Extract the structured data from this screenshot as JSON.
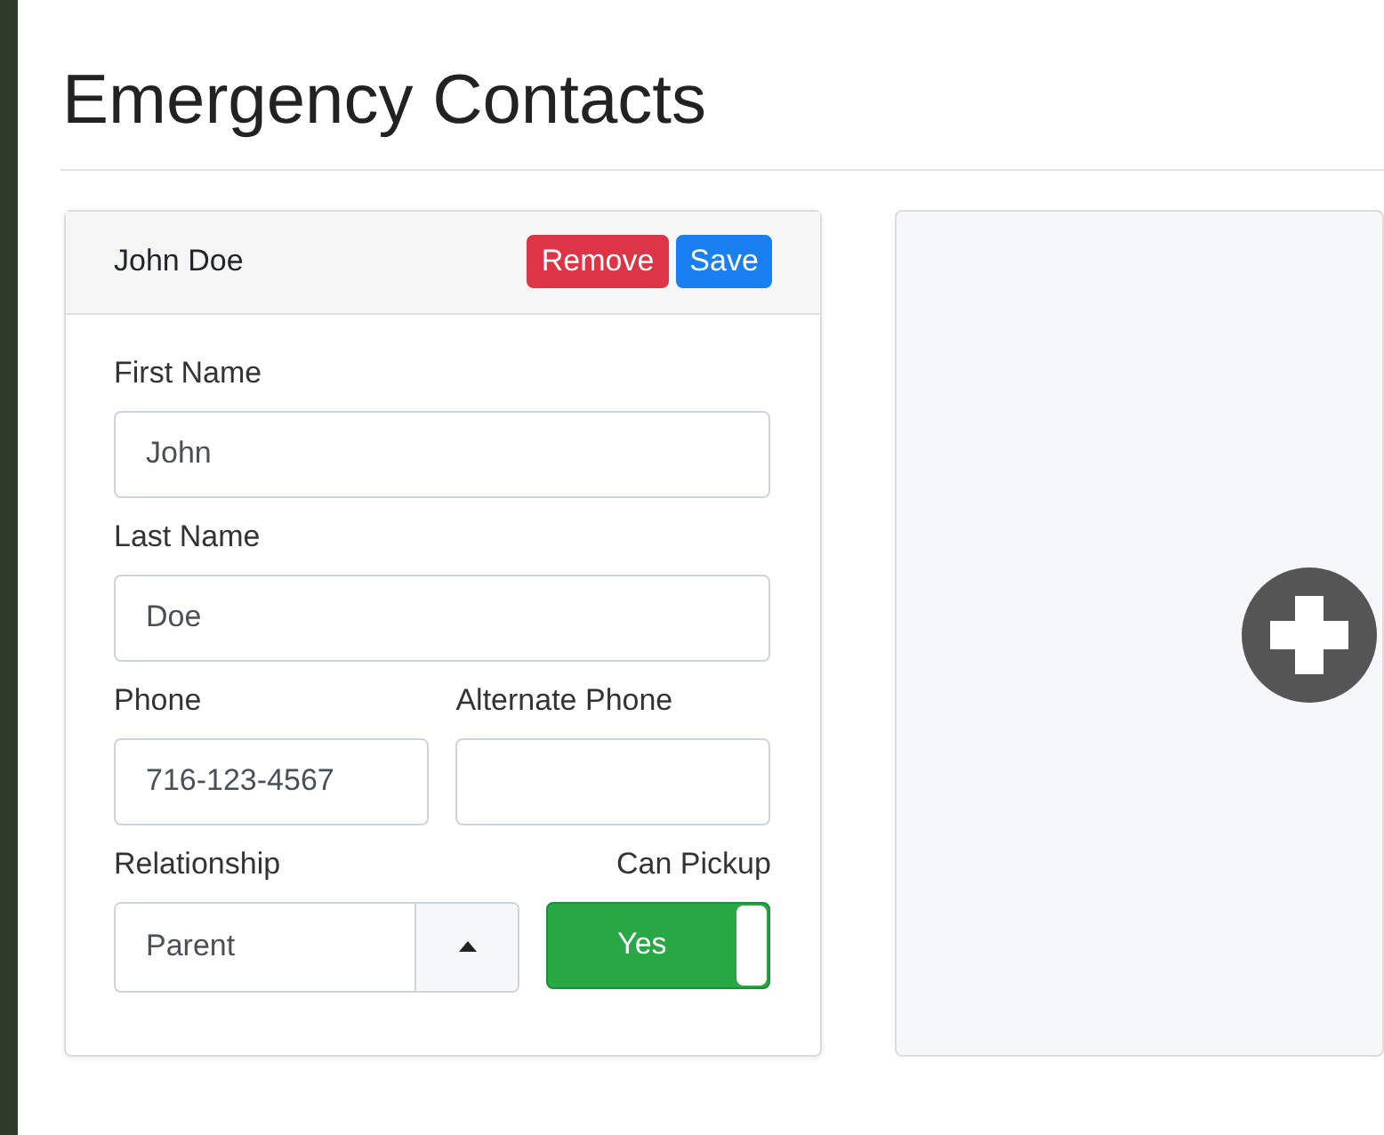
{
  "page": {
    "title": "Emergency Contacts"
  },
  "contacts": [
    {
      "header": "John Doe",
      "buttons": [
        {
          "kind": "remove",
          "label": "Remove"
        },
        {
          "kind": "save",
          "label": "Save"
        }
      ],
      "first_name": {
        "label": "First Name",
        "value": "John"
      },
      "last_name": {
        "label": "Last Name",
        "value": "Doe"
      },
      "phone": {
        "label": "Phone",
        "value": "716-123-4567"
      },
      "alternate_phone": {
        "label": "Alternate Phone"
      },
      "relationship": {
        "label": "Relationship",
        "value": "Parent"
      },
      "can_pickup": {
        "label": "Can Pickup",
        "on": true,
        "on_text": "Yes"
      }
    }
  ]
}
